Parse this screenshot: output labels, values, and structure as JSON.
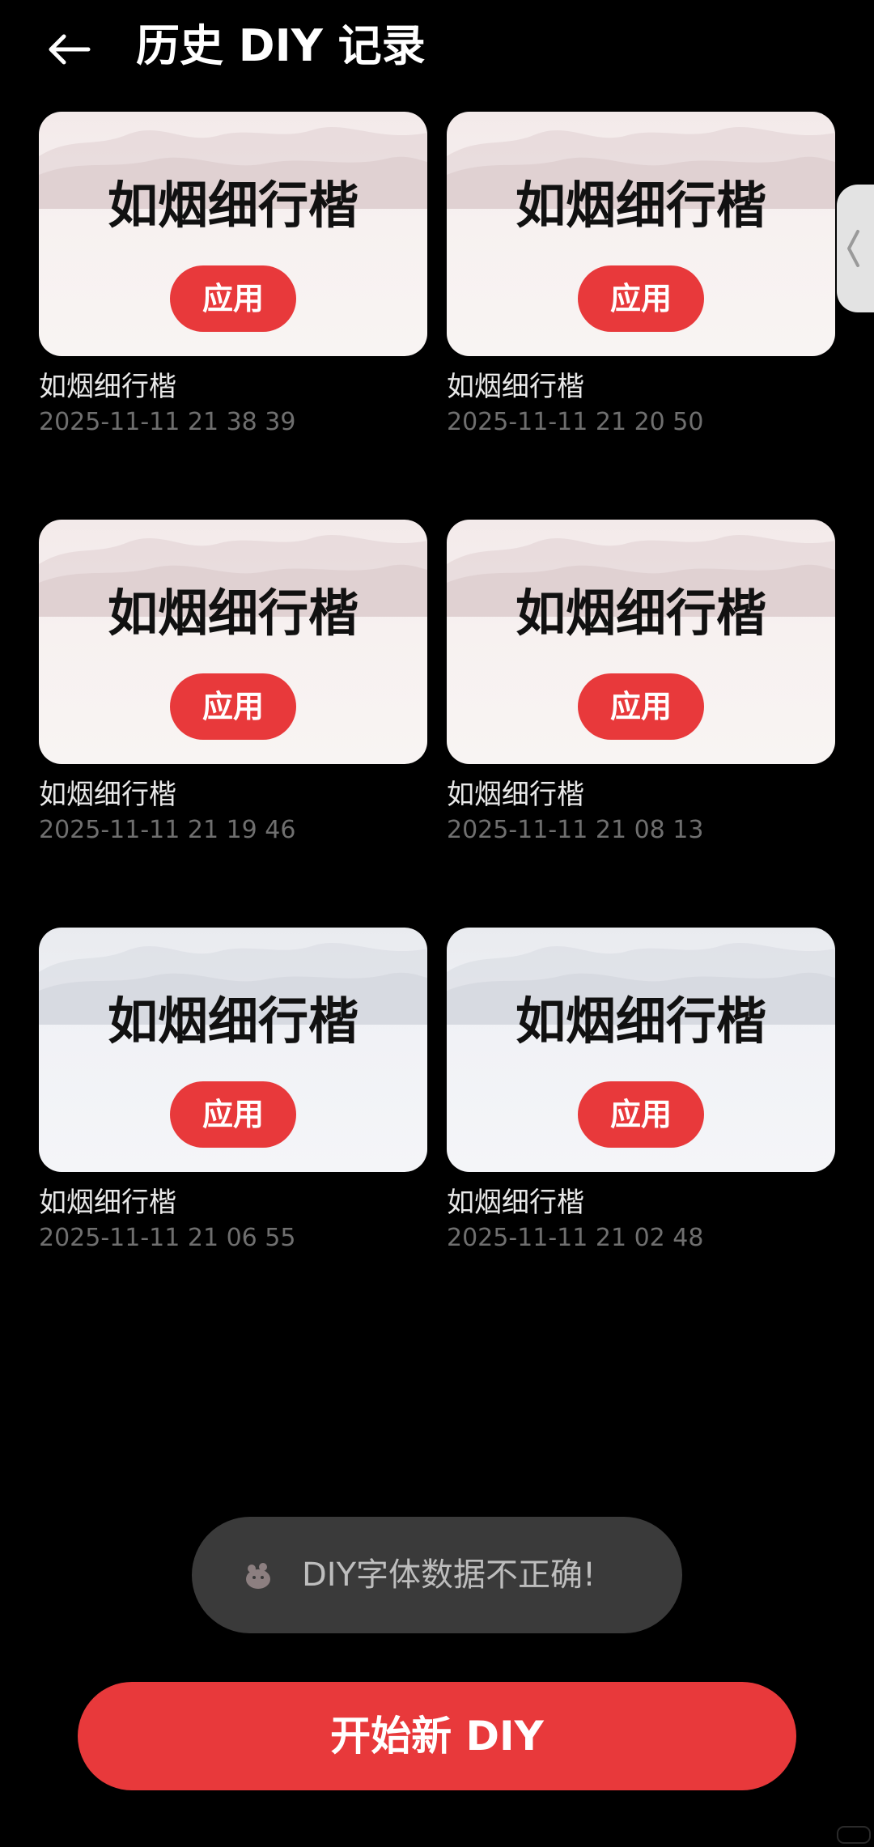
{
  "header": {
    "title": "历史 DIY 记录"
  },
  "history": [
    {
      "preview_text": "如烟细行楷",
      "apply_label": "应用",
      "name": "如烟细行楷",
      "time": "2025-11-11 21 38 39",
      "theme": "warm"
    },
    {
      "preview_text": "如烟细行楷",
      "apply_label": "应用",
      "name": "如烟细行楷",
      "time": "2025-11-11 21 20 50",
      "theme": "warm"
    },
    {
      "preview_text": "如烟细行楷",
      "apply_label": "应用",
      "name": "如烟细行楷",
      "time": "2025-11-11 21 19 46",
      "theme": "warm"
    },
    {
      "preview_text": "如烟细行楷",
      "apply_label": "应用",
      "name": "如烟细行楷",
      "time": "2025-11-11 21 08 13",
      "theme": "warm"
    },
    {
      "preview_text": "如烟细行楷",
      "apply_label": "应用",
      "name": "如烟细行楷",
      "time": "2025-11-11 21 06 55",
      "theme": "cool"
    },
    {
      "preview_text": "如烟细行楷",
      "apply_label": "应用",
      "name": "如烟细行楷",
      "time": "2025-11-11 21 02 48",
      "theme": "cool"
    }
  ],
  "toast": {
    "message": "DIY字体数据不正确!"
  },
  "footer": {
    "start_label": "开始新 DIY"
  },
  "colors": {
    "accent": "#e8393b",
    "background": "#000000",
    "toast_bg": "#3a3a3a"
  },
  "icons": {
    "back": "arrow-left-icon",
    "side_handle": "chevron-left-icon",
    "toast": "app-icon"
  }
}
